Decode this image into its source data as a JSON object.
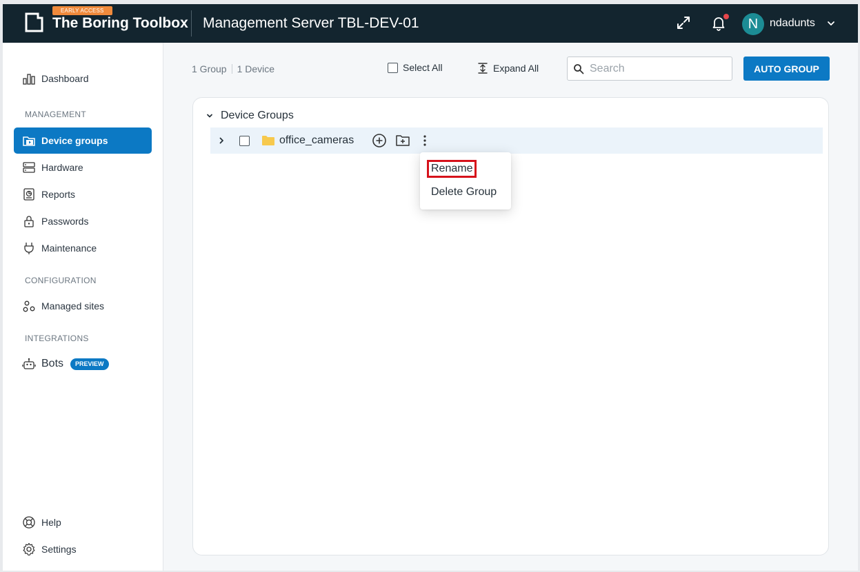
{
  "header": {
    "early_access": "EARLY ACCESS",
    "brand": "The Boring Toolbox",
    "server_title": "Management Server TBL-DEV-01",
    "avatar_initial": "N",
    "username": "ndadunts"
  },
  "sidebar": {
    "dashboard": "Dashboard",
    "management_label": "MANAGEMENT",
    "device_groups": "Device groups",
    "hardware": "Hardware",
    "reports": "Reports",
    "passwords": "Passwords",
    "maintenance": "Maintenance",
    "configuration_label": "CONFIGURATION",
    "managed_sites": "Managed sites",
    "integrations_label": "INTEGRATIONS",
    "bots": "Bots",
    "bots_badge": "PREVIEW",
    "help": "Help",
    "settings": "Settings"
  },
  "toolbar": {
    "group_count": "1 Group",
    "device_count": "1 Device",
    "select_all": "Select All",
    "expand_all": "Expand All",
    "search_placeholder": "Search",
    "auto_group": "AUTO GROUP"
  },
  "tree": {
    "root_label": "Device Groups",
    "rows": [
      {
        "name": "office_cameras"
      }
    ]
  },
  "context_menu": {
    "items": [
      "Rename",
      "Delete Group"
    ]
  },
  "colors": {
    "header_bg": "#13252f",
    "accent": "#0c79c4",
    "early_access": "#f08a3c",
    "row_highlight": "#ebf3fa",
    "annotation_red": "#d6121b",
    "folder": "#f7c94d"
  }
}
